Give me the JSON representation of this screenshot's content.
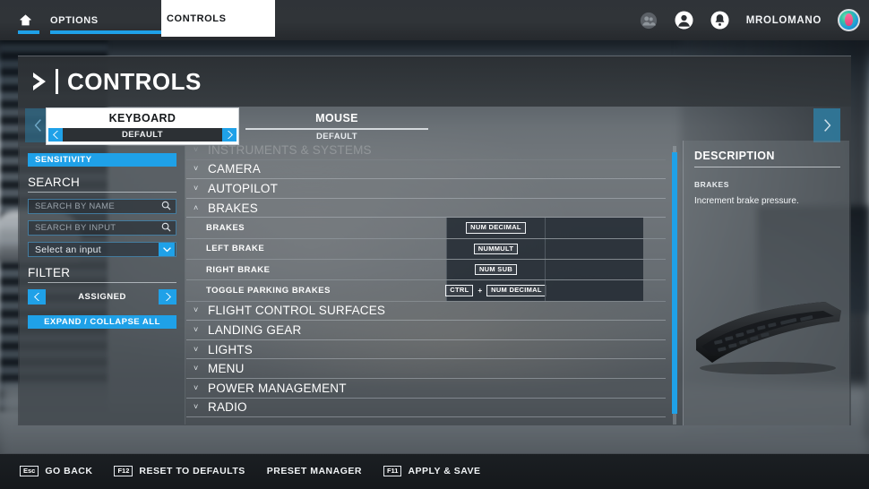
{
  "topbar": {
    "home_icon": "home-icon",
    "tabs": [
      {
        "label": "OPTIONS",
        "active": true
      },
      {
        "label": "CONTROLS",
        "active": true
      }
    ],
    "friends_icon": "friends-icon",
    "profile_icon": "profile-icon",
    "notifications_icon": "bell-icon",
    "username": "MROLOMANO",
    "avatar_icon": "user-avatar"
  },
  "dialog": {
    "title": "CONTROLS",
    "header_icon": "chevron-right-icon",
    "nav_prev_icon": "chevron-left-icon",
    "nav_next_icon": "chevron-right-icon",
    "devices": [
      {
        "name": "KEYBOARD",
        "preset": "DEFAULT",
        "selected": true
      },
      {
        "name": "MOUSE",
        "preset": "DEFAULT",
        "selected": false
      }
    ]
  },
  "sidebar": {
    "sensitivity_label": "SENSITIVITY",
    "search": {
      "title": "SEARCH",
      "by_name_placeholder": "SEARCH BY NAME",
      "by_name_value": "",
      "by_input_placeholder": "SEARCH BY INPUT",
      "by_input_value": "",
      "select_input_value": "Select an input",
      "search_icon": "magnifier-icon",
      "dropdown_icon": "chevron-down-icon"
    },
    "filter": {
      "title": "FILTER",
      "value": "ASSIGNED",
      "prev_icon": "chevron-left-icon",
      "next_icon": "chevron-right-icon"
    },
    "expand_collapse_label": "EXPAND / COLLAPSE ALL"
  },
  "list": {
    "groups": [
      {
        "name": "INSTRUMENTS & SYSTEMS",
        "expanded": false,
        "faded": true,
        "actions": []
      },
      {
        "name": "CAMERA",
        "expanded": false,
        "faded": false,
        "actions": []
      },
      {
        "name": "AUTOPILOT",
        "expanded": false,
        "faded": false,
        "actions": []
      },
      {
        "name": "BRAKES",
        "expanded": true,
        "faded": false,
        "actions": [
          {
            "name": "BRAKES",
            "primary": [
              "NUM DECIMAL"
            ],
            "secondary": []
          },
          {
            "name": "LEFT BRAKE",
            "primary": [
              "NUMMULT"
            ],
            "secondary": []
          },
          {
            "name": "RIGHT BRAKE",
            "primary": [
              "NUM SUB"
            ],
            "secondary": []
          },
          {
            "name": "TOGGLE PARKING BRAKES",
            "primary": [
              "CTRL",
              "NUM DECIMAL"
            ],
            "secondary": []
          }
        ]
      },
      {
        "name": "FLIGHT CONTROL SURFACES",
        "expanded": false,
        "faded": false,
        "actions": []
      },
      {
        "name": "LANDING GEAR",
        "expanded": false,
        "faded": false,
        "actions": []
      },
      {
        "name": "LIGHTS",
        "expanded": false,
        "faded": false,
        "actions": []
      },
      {
        "name": "MENU",
        "expanded": false,
        "faded": false,
        "actions": []
      },
      {
        "name": "POWER MANAGEMENT",
        "expanded": false,
        "faded": false,
        "actions": []
      },
      {
        "name": "RADIO",
        "expanded": false,
        "faded": false,
        "actions": []
      }
    ],
    "collapsed_icon": "chevron-down-icon",
    "expanded_icon": "chevron-up-icon",
    "key_separator": "+"
  },
  "description": {
    "title": "DESCRIPTION",
    "action_name": "BRAKES",
    "text": "Increment brake pressure.",
    "device_image": "keyboard-photo"
  },
  "bottombar": {
    "items": [
      {
        "key": "Esc",
        "label": "GO BACK"
      },
      {
        "key": "F12",
        "label": "RESET TO DEFAULTS"
      },
      {
        "key": "",
        "label": "PRESET MANAGER"
      },
      {
        "key": "F11",
        "label": "APPLY & SAVE"
      }
    ]
  },
  "colors": {
    "accent": "#1fa1e8",
    "panel": "#3a3f44",
    "text": "#ffffff"
  }
}
